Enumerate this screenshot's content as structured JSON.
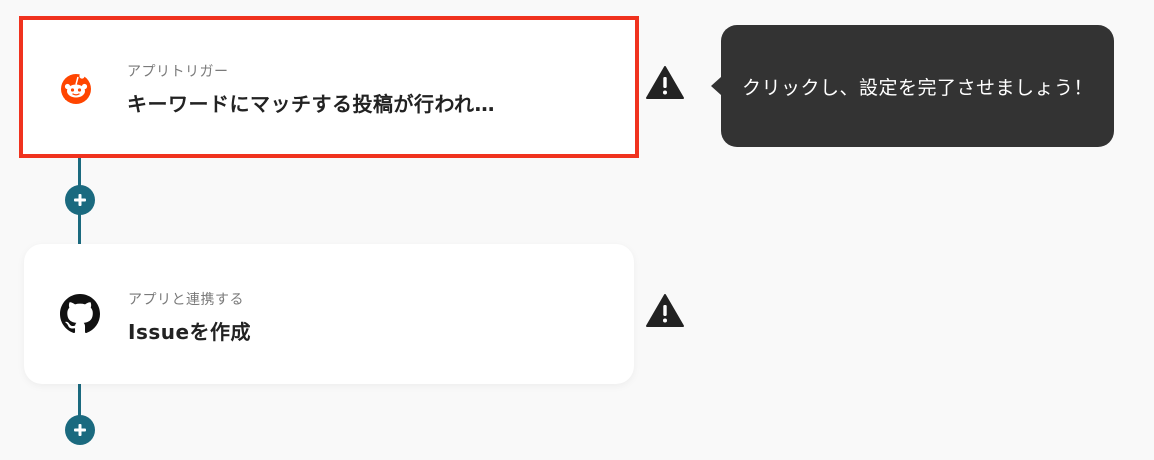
{
  "flow": {
    "steps": [
      {
        "subtitle": "アプリトリガー",
        "title": "キーワードにマッチする投稿が行われ…",
        "icon": "reddit-icon",
        "selected": true,
        "warning_icon": "warning-icon"
      },
      {
        "subtitle": "アプリと連携する",
        "title": "Issueを作成",
        "icon": "github-icon",
        "selected": false,
        "warning_icon": "warning-icon"
      }
    ],
    "add_step_icon": "plus-icon",
    "connector_color": "#1b6a7f",
    "selection_color": "#f0321e"
  },
  "tooltip": {
    "text": "クリックし、設定を完了させましょう！"
  },
  "colors": {
    "reddit": "#ff4500",
    "tooltip_bg": "#333333"
  }
}
